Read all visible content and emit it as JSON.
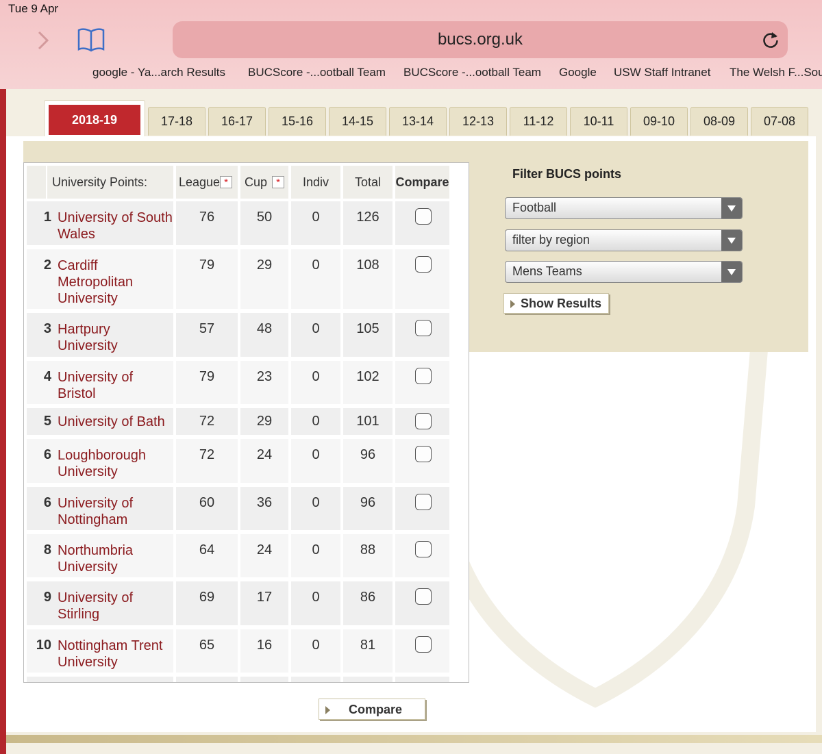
{
  "status": {
    "time": "Tue 9 Apr"
  },
  "browser": {
    "url": "bucs.org.uk",
    "favorites": [
      "google - Ya...arch Results",
      "BUCScore -...ootball Team",
      "BUCScore -...ootball Team",
      "Google",
      "USW Staff Intranet",
      "The Welsh F...Sou"
    ]
  },
  "season_tabs": [
    "2018-19",
    "17-18",
    "16-17",
    "15-16",
    "14-15",
    "13-14",
    "12-13",
    "11-12",
    "10-11",
    "09-10",
    "08-09",
    "07-08"
  ],
  "table": {
    "headers": {
      "university": "University Points:",
      "league": "League",
      "cup": "Cup",
      "indiv": "Indiv",
      "total": "Total",
      "compare": "Compare"
    },
    "star_glyph": "*",
    "rows": [
      {
        "rank": "1",
        "name": "University of South Wales",
        "league": "76",
        "cup": "50",
        "indiv": "0",
        "total": "126"
      },
      {
        "rank": "2",
        "name": "Cardiff Metropolitan University",
        "league": "79",
        "cup": "29",
        "indiv": "0",
        "total": "108"
      },
      {
        "rank": "3",
        "name": "Hartpury University",
        "league": "57",
        "cup": "48",
        "indiv": "0",
        "total": "105"
      },
      {
        "rank": "4",
        "name": "University of Bristol",
        "league": "79",
        "cup": "23",
        "indiv": "0",
        "total": "102"
      },
      {
        "rank": "5",
        "name": "University of Bath",
        "league": "72",
        "cup": "29",
        "indiv": "0",
        "total": "101"
      },
      {
        "rank": "6",
        "name": "Loughborough University",
        "league": "72",
        "cup": "24",
        "indiv": "0",
        "total": "96"
      },
      {
        "rank": "6",
        "name": "University of Nottingham",
        "league": "60",
        "cup": "36",
        "indiv": "0",
        "total": "96"
      },
      {
        "rank": "8",
        "name": "Northumbria University",
        "league": "64",
        "cup": "24",
        "indiv": "0",
        "total": "88"
      },
      {
        "rank": "9",
        "name": "University of Stirling",
        "league": "69",
        "cup": "17",
        "indiv": "0",
        "total": "86"
      },
      {
        "rank": "10",
        "name": "Nottingham Trent University",
        "league": "65",
        "cup": "16",
        "indiv": "0",
        "total": "81"
      }
    ]
  },
  "filter": {
    "title": "Filter BUCS points",
    "sport": "Football",
    "region": "filter by region",
    "gender": "Mens Teams",
    "show_results": "Show Results"
  },
  "compare_button": "Compare",
  "colors": {
    "brand_red": "#c0282d",
    "link_red": "#8b1a1e",
    "panel_beige": "#e9e2c9"
  }
}
